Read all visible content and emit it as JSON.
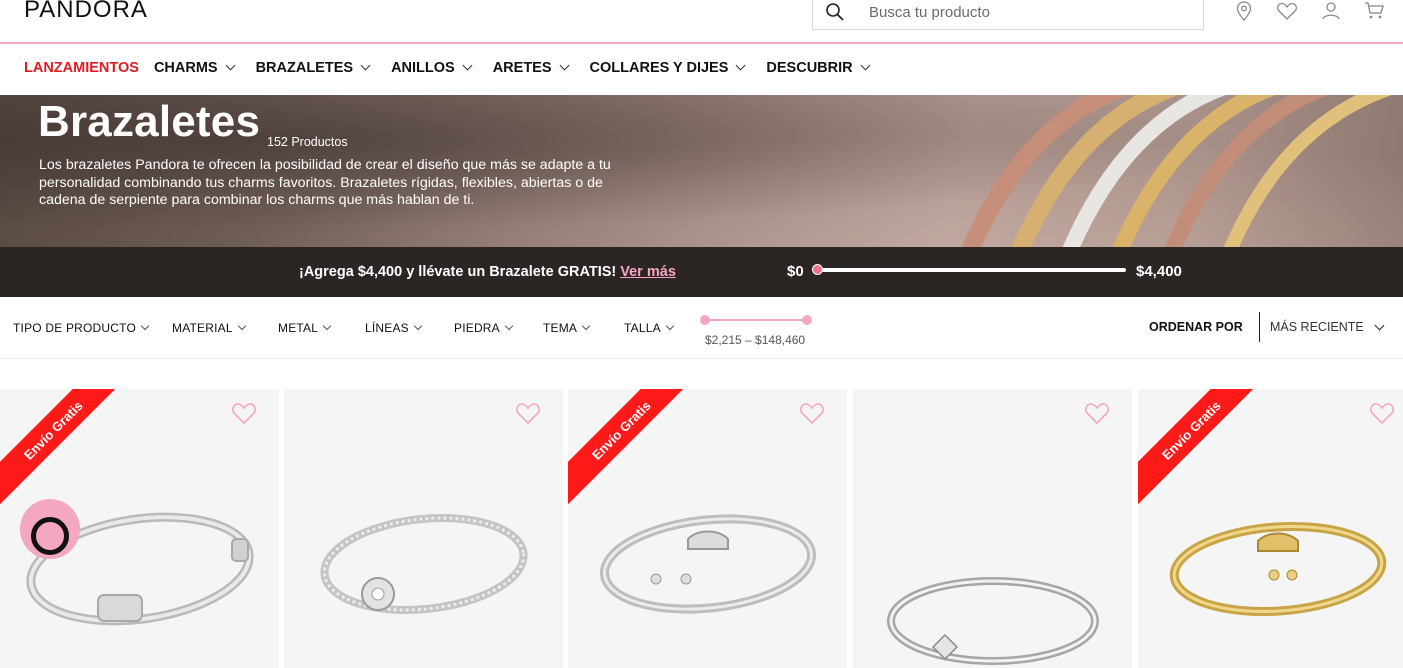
{
  "header": {
    "logo": "PANDORA",
    "search_placeholder": "Busca tu producto"
  },
  "icons": [
    "search-icon",
    "location-icon",
    "heart-icon",
    "user-icon",
    "cart-icon"
  ],
  "nav": {
    "items": [
      {
        "label": "LANZAMIENTOS",
        "active": true
      },
      {
        "label": "CHARMS"
      },
      {
        "label": "BRAZALETES"
      },
      {
        "label": "ANILLOS"
      },
      {
        "label": "ARETES"
      },
      {
        "label": "COLLARES Y DIJES"
      },
      {
        "label": "DESCUBRIR"
      }
    ]
  },
  "hero": {
    "title": "Brazaletes",
    "count": "152 Productos",
    "description": "Los brazaletes Pandora te ofrecen la posibilidad de crear el diseño que más se adapte a tu personalidad combinando tus charms favoritos. Brazaletes rígidas, flexibles, abiertas o de cadena de serpiente para combinar los charms que más hablan de ti."
  },
  "promo": {
    "text": "¡Agrega $4,400 y llévate un Brazalete GRATIS!",
    "link": "Ver más",
    "min_label": "$0",
    "max_label": "$4,400",
    "progress": 0
  },
  "filters": {
    "items": [
      "TIPO DE PRODUCTO",
      "MATERIAL",
      "METAL",
      "LÍNEAS",
      "PIEDRA",
      "TEMA",
      "TALLA"
    ],
    "price_range": "$2,215 – $148,460",
    "sort_label": "ORDENAR POR",
    "sort_value": "MÁS RECIENTE"
  },
  "products": [
    {
      "ribbon": "Envío Gratis",
      "badge": true,
      "metal": "silver"
    },
    {
      "ribbon": "",
      "badge": false,
      "metal": "silver"
    },
    {
      "ribbon": "Envío Gratis",
      "badge": false,
      "metal": "silver"
    },
    {
      "ribbon": "",
      "badge": false,
      "metal": "silver"
    },
    {
      "ribbon": "Envío Gratis",
      "badge": false,
      "metal": "gold"
    }
  ],
  "colors": {
    "accent_pink": "#f4a7c0",
    "active_red": "#e11b22",
    "ribbon_red": "#ff1a1a",
    "promo_bg": "#2b2624"
  }
}
